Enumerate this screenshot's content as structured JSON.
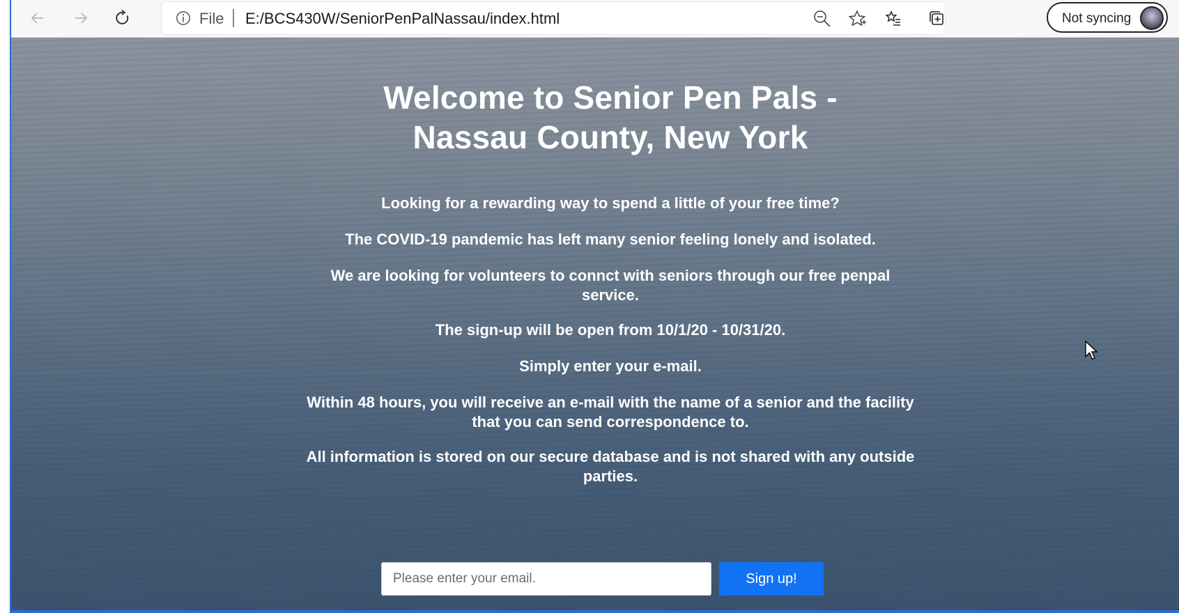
{
  "browser": {
    "address_scheme": "File",
    "address_url": "E:/BCS430W/SeniorPenPalNassau/index.html",
    "profile_label": "Not syncing",
    "icons": [
      "back-arrow-icon",
      "forward-arrow-icon",
      "refresh-icon",
      "info-icon",
      "zoom-out-icon",
      "star-icon",
      "favorites-icon",
      "collections-icon",
      "avatar",
      "more-icon"
    ]
  },
  "page": {
    "title_line1": "Welcome to Senior Pen Pals -",
    "title_line2": "Nassau County, New York",
    "paragraphs": [
      "Looking for a rewarding way to spend a little of your free time?",
      "The COVID-19 pandemic has left many senior feeling lonely and isolated.",
      "We are looking for volunteers to connct with seniors through our free penpal service.",
      "The sign-up will be open from 10/1/20 - 10/31/20.",
      "Simply enter your e-mail.",
      "Within 48 hours, you will receive an e-mail with the name of a senior and the facility that you can send correspondence to.",
      "All information is stored on our secure database and is not shared with any outside parties."
    ],
    "email_placeholder": "Please enter your email.",
    "email_value": "",
    "signup_label": "Sign up!"
  },
  "colors": {
    "accent_button": "#1272f4",
    "page_text": "#ffffff"
  }
}
